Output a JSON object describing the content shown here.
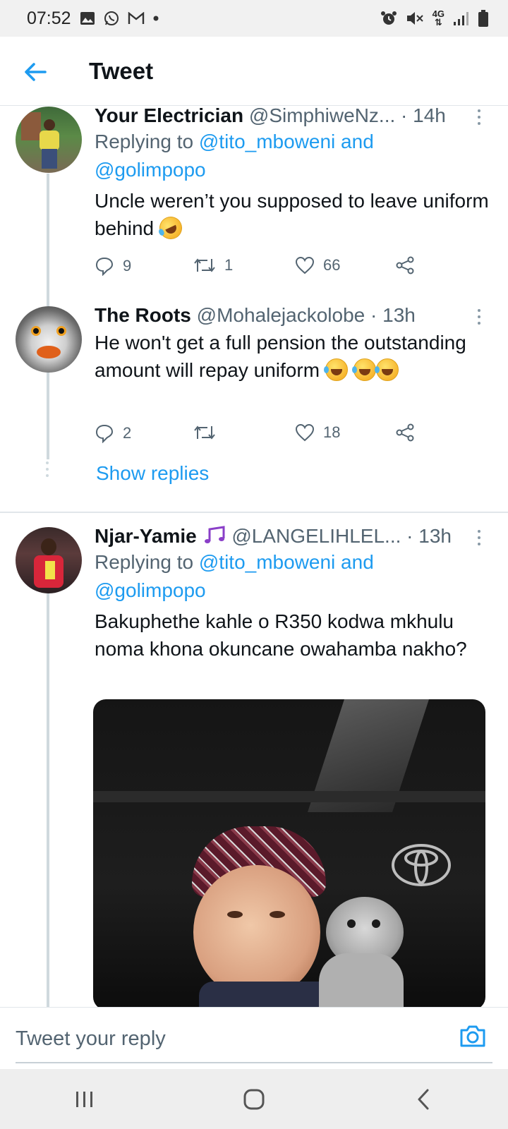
{
  "status_bar": {
    "time": "07:52",
    "left_icons": [
      "gallery-icon",
      "whatsapp-icon",
      "gmail-icon",
      "dot-icon"
    ],
    "right_icons": [
      "alarm-icon",
      "mute-icon",
      "4g-icon",
      "signal-icon",
      "battery-icon"
    ],
    "network": "4G"
  },
  "header": {
    "title": "Tweet",
    "back_icon": "arrow-left-icon"
  },
  "tweets": [
    {
      "name": "Your Electrician",
      "handle": "@SimphiweNz...",
      "time": "· 14h",
      "replying_prefix": "Replying to ",
      "replying_to": "@tito_mboweni and @golimpopo",
      "text": "Uncle weren’t you supposed to leave uniform behind",
      "emoji": [
        "rolling-on-floor-laughing-emoji"
      ],
      "replies": "9",
      "retweets": "1",
      "likes": "66"
    },
    {
      "name": "The Roots",
      "handle": "@Mohalejackolobe",
      "time": "· 13h",
      "text": "He won't get a full pension the outstanding amount will repay uniform",
      "emoji": [
        "tears-of-joy-emoji",
        "tears-of-joy-emoji",
        "tears-of-joy-emoji"
      ],
      "replies": "2",
      "retweets": "",
      "likes": "18",
      "show_replies": "Show replies"
    },
    {
      "name": "Njar-Yamie",
      "name_emoji": "musical-notes-emoji",
      "handle": "@LANGELIHLEL...",
      "time": "· 13h",
      "replying_prefix": "Replying to ",
      "replying_to": "@tito_mboweni and @golimpopo",
      "text": "Bakuphethe kahle o R350 kodwa mkhulu noma khona okuncane owahamba nakho?",
      "media": "photo-child-with-kitten"
    }
  ],
  "reply_bar": {
    "placeholder": "Tweet your reply",
    "camera_icon": "camera-icon"
  },
  "nav_bar": {
    "buttons": [
      "recents-icon",
      "home-icon",
      "back-icon"
    ]
  },
  "colors": {
    "accent": "#1d9bf0",
    "text": "#0f1419",
    "secondary": "#536471",
    "thread_line": "#cfd9de"
  }
}
